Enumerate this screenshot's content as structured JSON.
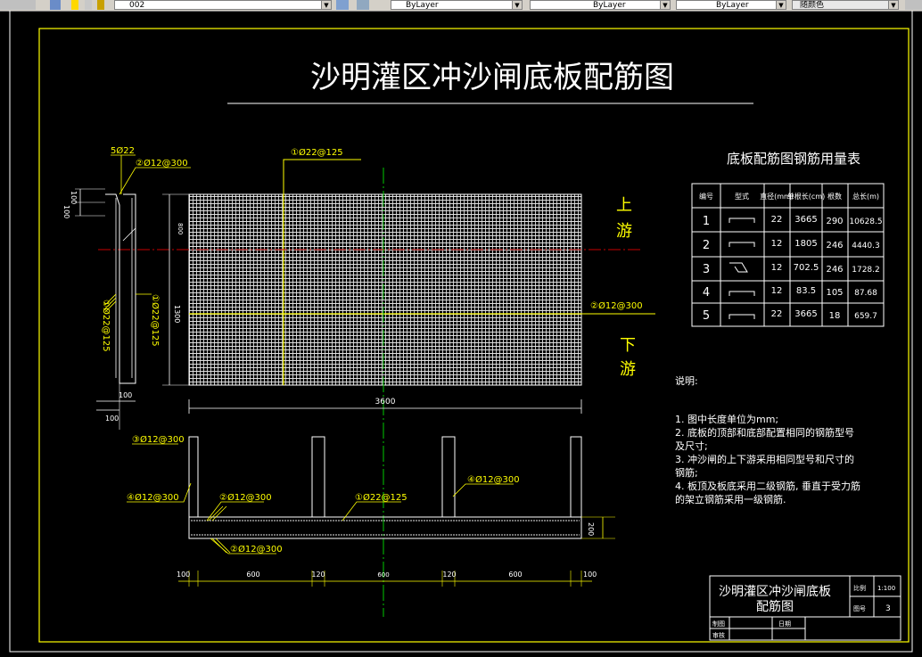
{
  "toolbar": {
    "layer_value": "002",
    "color_value": "ByLayer",
    "linetype_value": "ByLayer",
    "lineweight_value": "ByLayer",
    "plotstyle_value": "随颜色"
  },
  "drawing": {
    "main_title": "沙明灌区冲沙闸底板配筋图",
    "upstream": [
      "上",
      "游"
    ],
    "downstream": [
      "下",
      "游"
    ],
    "labels": {
      "top_bar": "①Ø22@125",
      "right_bar": "②Ø12@300",
      "left_5": "5Ø22",
      "left_2": "②Ø12@300",
      "left_vert_1": "①Ø22@125",
      "left_vert_2": "①Ø22@125",
      "left_3": "③Ø12@300",
      "sec_4a": "④Ø12@300",
      "sec_2": "②Ø12@300",
      "sec_1": "①Ø22@125",
      "sec_4b": "④Ø12@300",
      "sec_2b": "②Ø12@300"
    },
    "dims": {
      "w100a": "100",
      "w100b": "100",
      "h800": "800",
      "h1300": "1300",
      "left100a": "100",
      "left100b": "100",
      "plan_width": "3600",
      "sec_200": "200",
      "b100a": "100",
      "b600a": "600",
      "b120a": "120",
      "b600mid": "600",
      "b120b": "120",
      "b600b": "600",
      "b100b": "100"
    }
  },
  "rebar_table": {
    "title": "底板配筋图钢筋用量表",
    "headers": [
      "编号",
      "型式",
      "直径(mm)",
      "单根长(cm)",
      "根数",
      "总长(m)"
    ],
    "rows": [
      {
        "no": "1",
        "dia": "22",
        "len": "3665",
        "count": "290",
        "total": "10628.5"
      },
      {
        "no": "2",
        "dia": "12",
        "len": "1805",
        "count": "246",
        "total": "4440.3"
      },
      {
        "no": "3",
        "dia": "12",
        "len": "702.5",
        "count": "246",
        "total": "1728.2"
      },
      {
        "no": "4",
        "dia": "12",
        "len": "83.5",
        "count": "105",
        "total": "87.68"
      },
      {
        "no": "5",
        "dia": "22",
        "len": "3665",
        "count": "18",
        "total": "659.7"
      }
    ]
  },
  "notes": {
    "heading": "说明:",
    "lines": [
      "1. 图中长度单位为mm;",
      "2. 底板的顶部和底部配置相同的钢筋型号",
      "   及尺寸;",
      "3. 冲沙闸的上下游采用相同型号和尺寸的",
      "   钢筋;",
      "4. 板顶及板底采用二级钢筋, 垂直于受力筋",
      "   的架立钢筋采用一级钢筋."
    ]
  },
  "title_block": {
    "name_line1": "沙明灌区冲沙闸底板",
    "name_line2": "配筋图",
    "scale_label": "比例",
    "scale_value": "1:100",
    "sheet_label": "图号",
    "sheet_value": "3",
    "drawn_label": "制图",
    "date_label": "日期",
    "check_label": "审核"
  },
  "colors": {
    "frame": "#ffff00",
    "mesh": "#e6e6e6",
    "centerline": "#00c800",
    "axis_red": "#c80000",
    "dim_text": "#ffffff"
  }
}
